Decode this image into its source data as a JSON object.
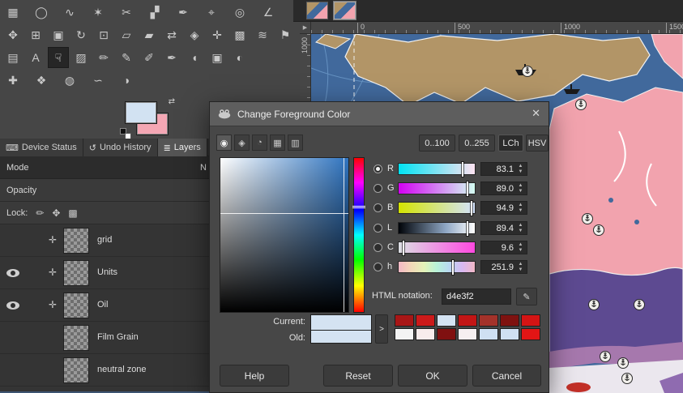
{
  "toolbox": {
    "rows": [
      {
        "tools": [
          {
            "name": "rectangle-select",
            "glyph": "▦"
          },
          {
            "name": "ellipse-select",
            "glyph": "◯"
          },
          {
            "name": "free-select",
            "glyph": "∿"
          },
          {
            "name": "fuzzy-select",
            "glyph": "✶"
          },
          {
            "name": "scissors-select",
            "glyph": "✂"
          },
          {
            "name": "foreground-select",
            "glyph": "▞"
          },
          {
            "name": "paths",
            "glyph": "✒"
          },
          {
            "name": "color-picker",
            "glyph": "⌖"
          },
          {
            "name": "zoom",
            "glyph": "◎"
          },
          {
            "name": "measure",
            "glyph": "∠"
          }
        ]
      },
      {
        "tools": [
          {
            "name": "move",
            "glyph": "✥"
          },
          {
            "name": "alignment",
            "glyph": "⊞"
          },
          {
            "name": "crop",
            "glyph": "▣"
          },
          {
            "name": "rotate",
            "glyph": "↻"
          },
          {
            "name": "scale",
            "glyph": "⊡"
          },
          {
            "name": "shear",
            "glyph": "▱"
          },
          {
            "name": "perspective",
            "glyph": "▰"
          },
          {
            "name": "flip",
            "glyph": "⇄"
          },
          {
            "name": "unified-transform",
            "glyph": "◈"
          },
          {
            "name": "handle-transform",
            "glyph": "✛"
          },
          {
            "name": "cage-transform",
            "glyph": "▩"
          },
          {
            "name": "warp-transform",
            "glyph": "≋"
          },
          {
            "name": "seamless-clone",
            "glyph": "⚑"
          }
        ]
      },
      {
        "tools": [
          {
            "name": "gradient",
            "glyph": "▤"
          },
          {
            "name": "text",
            "glyph": "A"
          },
          {
            "name": "smudge",
            "glyph": "☟",
            "selected": true
          },
          {
            "name": "eraser",
            "glyph": "▨"
          },
          {
            "name": "pencil",
            "glyph": "✏"
          },
          {
            "name": "paintbrush",
            "glyph": "✎"
          },
          {
            "name": "airbrush",
            "glyph": "✐"
          },
          {
            "name": "ink",
            "glyph": "✒"
          },
          {
            "name": "mypaint-brush",
            "glyph": "◖"
          },
          {
            "name": "clone",
            "glyph": "▣"
          },
          {
            "name": "dodge-burn",
            "glyph": "◐"
          }
        ]
      },
      {
        "tools": [
          {
            "name": "heal",
            "glyph": "✚"
          },
          {
            "name": "perspective-clone",
            "glyph": "❖"
          },
          {
            "name": "blur-sharpen",
            "glyph": "◍"
          },
          {
            "name": "smudge-finger",
            "glyph": "∽"
          },
          {
            "name": "dodge",
            "glyph": "◑"
          }
        ]
      }
    ],
    "fg_color": "#d2e2f2",
    "bg_color": "#f4a7b4",
    "swap_glyph": "⇄"
  },
  "dock": {
    "tabs": [
      {
        "label": "Device Status",
        "icon": "⌨"
      },
      {
        "label": "Undo History",
        "icon": "↺"
      },
      {
        "label": "Layers",
        "icon": "≣"
      }
    ],
    "mode_label": "Mode",
    "mode_value": "N",
    "opacity_label": "Opacity",
    "lock_label": "Lock:",
    "lock_icons": [
      "✏",
      "✥",
      "▩"
    ],
    "link_glyph": "✛",
    "layers": [
      {
        "name": "grid",
        "visible": false,
        "linked": true
      },
      {
        "name": "Units",
        "visible": true,
        "linked": true
      },
      {
        "name": "Oil",
        "visible": true,
        "linked": true
      },
      {
        "name": "Film Grain",
        "visible": false,
        "linked": false
      },
      {
        "name": "neutral zone",
        "visible": false,
        "linked": false
      }
    ]
  },
  "dialog": {
    "title": "Change Foreground Color",
    "close_glyph": "✕",
    "tab_icons": [
      "◉",
      "◈",
      "◔",
      "▦",
      "▥"
    ],
    "range_buttons": [
      "0..100",
      "0..255"
    ],
    "space_buttons": [
      "LCh",
      "HSV"
    ],
    "channels": [
      {
        "id": "R",
        "value": "83.1",
        "pct": 83,
        "selected": true
      },
      {
        "id": "G",
        "value": "89.0",
        "pct": 89
      },
      {
        "id": "B",
        "value": "94.9",
        "pct": 95
      },
      {
        "id": "L",
        "value": "89.4",
        "pct": 89
      },
      {
        "id": "C",
        "value": "9.6",
        "pct": 5
      },
      {
        "id": "h",
        "value": "251.9",
        "pct": 70
      }
    ],
    "spin_up": "▲",
    "spin_down": "▼",
    "html_label": "HTML notation:",
    "html_value": "d4e3f2",
    "picker_glyph": "✎",
    "current_label": "Current:",
    "old_label": "Old:",
    "current_color": "#d4e3f2",
    "old_color": "#d4e3f2",
    "history_glyph": ">",
    "palette_row1": [
      "#a81616",
      "#cc1a1a",
      "#d4e3f2",
      "#c21515",
      "#a3322a",
      "#7e1210",
      "#d41414"
    ],
    "palette_row2": [
      "#f4f4f4",
      "#f8ecec",
      "#801010",
      "#f6eff1",
      "#cfe0f2",
      "#cfe0f2",
      "#e21515"
    ],
    "buttons": [
      "Help",
      "Reset",
      "OK",
      "Cancel"
    ]
  },
  "canvas": {
    "h_ruler_labels": [
      "0",
      "500",
      "1000",
      "1500"
    ],
    "v_ruler_label": "1000",
    "corner_glyph": "▶",
    "map_colors": {
      "ocean": "#41699c",
      "land": "#b29567",
      "pink": "#f2a3ae",
      "purple": "#5d4a91",
      "violet": "#a678ad",
      "pale": "#ebe7ee",
      "red": "#c23028"
    }
  }
}
